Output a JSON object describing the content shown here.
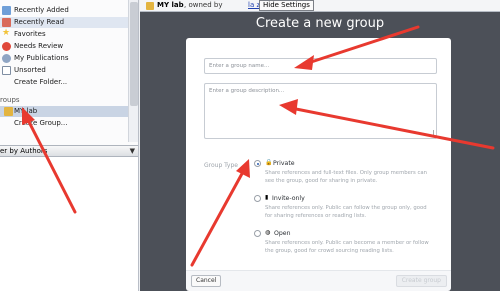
{
  "library": {
    "items": [
      {
        "label": "Recently Added",
        "icon": "clock-icon",
        "color": "#6f9fd8"
      },
      {
        "label": "Recently Read",
        "icon": "book-icon",
        "color": "#d96a5a"
      },
      {
        "label": "Favorites",
        "icon": "star-icon",
        "color": "#f2c33a"
      },
      {
        "label": "Needs Review",
        "icon": "review-icon",
        "color": "#e0483a"
      },
      {
        "label": "My Publications",
        "icon": "person-icon",
        "color": "#8fa5c4"
      },
      {
        "label": "Unsorted",
        "icon": "unsorted-icon",
        "color": "#7f8ea3"
      },
      {
        "label": "Create Folder...",
        "icon": "",
        "color": ""
      }
    ],
    "groups_heading": "roups",
    "group_items": [
      {
        "label": "MY lab",
        "icon": "group-icon",
        "color": "#e3b440"
      },
      {
        "label": "Create Group...",
        "icon": "",
        "color": ""
      }
    ],
    "filter_label": "er by Authors",
    "filter_chevron": "▼"
  },
  "topbar": {
    "group_name": "MY lab",
    "owned_by": ", owned by",
    "owner": "la zoze",
    "hide_settings": "Hide Settings"
  },
  "modal": {
    "title": "Create a new group",
    "name_placeholder": "Enter a group name...",
    "description_placeholder": "Enter a group description...",
    "group_type_label": "Group Type",
    "options": [
      {
        "title": "Private",
        "icon": "lock-icon",
        "glyph": "🔒",
        "selected": true,
        "desc1": "Share references and full-text files. Only group members can",
        "desc2": "see the group, good for sharing in private."
      },
      {
        "title": "Invite-only",
        "icon": "invite-icon",
        "glyph": "▮",
        "selected": false,
        "desc1": "Share references only. Public can follow the group only, good",
        "desc2": "for sharing references or reading lists."
      },
      {
        "title": "Open",
        "icon": "globe-icon",
        "glyph": "◍",
        "selected": false,
        "desc1": "Share references only. Public can become a member or follow",
        "desc2": "the group, good for crowd sourcing reading lists."
      }
    ],
    "cancel": "Cancel",
    "create": "Create group"
  },
  "colors": {
    "arrow": "#e8392f",
    "overlay": "#4c5058",
    "accent": "#2b5eb2"
  }
}
